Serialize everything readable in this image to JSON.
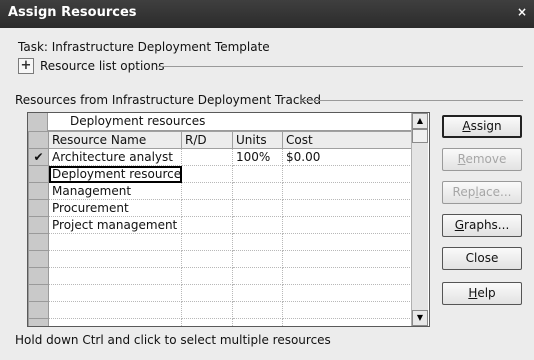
{
  "window": {
    "title": "Assign Resources",
    "close_glyph": "×"
  },
  "task": {
    "label": "Task: Infrastructure Deployment Template"
  },
  "options": {
    "expand_glyph": "+",
    "label": "Resource list options"
  },
  "group": {
    "label": "Resources from Infrastructure Deployment Tracked"
  },
  "grid": {
    "edit_value": "Deployment resources",
    "columns": [
      "Resource Name",
      "R/D",
      "Units",
      "Cost"
    ],
    "rows": [
      {
        "check": "✔",
        "name": "Architecture analyst",
        "rd": "",
        "units": "100%",
        "cost": "$0.00"
      },
      {
        "check": "",
        "name": "Deployment resources",
        "rd": "",
        "units": "",
        "cost": ""
      },
      {
        "check": "",
        "name": "Management",
        "rd": "",
        "units": "",
        "cost": ""
      },
      {
        "check": "",
        "name": "Procurement",
        "rd": "",
        "units": "",
        "cost": ""
      },
      {
        "check": "",
        "name": "Project management",
        "rd": "",
        "units": "",
        "cost": ""
      },
      {
        "check": "",
        "name": "",
        "rd": "",
        "units": "",
        "cost": ""
      },
      {
        "check": "",
        "name": "",
        "rd": "",
        "units": "",
        "cost": ""
      },
      {
        "check": "",
        "name": "",
        "rd": "",
        "units": "",
        "cost": ""
      },
      {
        "check": "",
        "name": "",
        "rd": "",
        "units": "",
        "cost": ""
      },
      {
        "check": "",
        "name": "",
        "rd": "",
        "units": "",
        "cost": ""
      },
      {
        "check": "",
        "name": "",
        "rd": "",
        "units": "",
        "cost": ""
      }
    ],
    "selected_row": 1
  },
  "buttons": {
    "assign": {
      "pre": "",
      "key": "A",
      "post": "ssign",
      "enabled": true
    },
    "remove": {
      "pre": "",
      "key": "R",
      "post": "emove",
      "enabled": false
    },
    "replace": {
      "pre": "Rep",
      "key": "l",
      "post": "ace...",
      "enabled": false
    },
    "graphs": {
      "pre": "",
      "key": "G",
      "post": "raphs...",
      "enabled": true
    },
    "close": {
      "pre": "Close",
      "key": "",
      "post": "",
      "enabled": true
    },
    "help": {
      "pre": "",
      "key": "H",
      "post": "elp",
      "enabled": true
    }
  },
  "hint": "Hold down Ctrl and click to select multiple resources",
  "colors": {
    "titlebar": "#2b2b2b",
    "window_bg": "#ececec",
    "disabled_text": "#a6a6a6"
  }
}
